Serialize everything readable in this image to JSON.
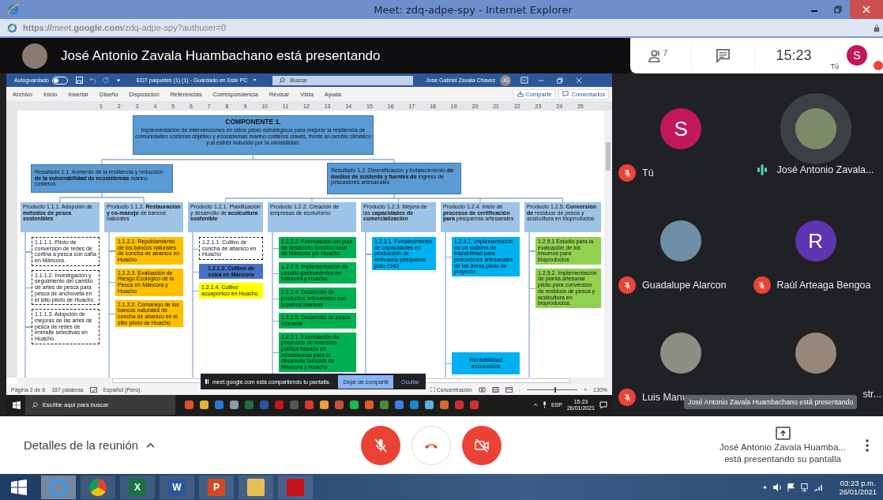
{
  "browser": {
    "title": "Meet: zdq-adpe-spy - Internet Explorer",
    "url": "**https://**meet.**google.com**/zdq-adpe-spy?authuser=0"
  },
  "presenting_banner": {
    "text": "José Antonio Zavala Huambachano está presentando"
  },
  "top_card": {
    "people_count": "7",
    "clock": "15:23",
    "self_label": "Tú",
    "self_initial": "S",
    "self_muted": true
  },
  "word": {
    "autosave_label": "Autoguardado",
    "autosave_on": false,
    "doc_title": "EDT paquetes (1) (1)  -  Guardado en Este PC",
    "search_placeholder": "Buscar",
    "user": "Jose Gabriel Zavala Chavez",
    "user_initials": "JG",
    "menu": [
      "Archivo",
      "Inicio",
      "Insertar",
      "Diseño",
      "Disposición",
      "Referencias",
      "Correspondencia",
      "Revisar",
      "Vista",
      "Ayuda"
    ],
    "share_button": "Compartir",
    "comments_button": "Comentarios",
    "ruler": [
      "1",
      "2",
      "3",
      "4",
      "5",
      "6",
      "7",
      "8",
      "9",
      "10",
      "11",
      "12",
      "13",
      "14",
      "15",
      "16",
      "17",
      "18",
      "19",
      "20",
      "21",
      "22",
      "23",
      "24",
      "25"
    ],
    "diagram": {
      "kind": "component",
      "title": "COMPONENTE 1.",
      "text": "Implementación de intervenciones en sitios piloto estratégicos para mejorar la resiliencia de comunidades costeras objetivo y ecosistemas marino costeros claves, frente al cambio climático y al estrés inducido por la variabilidad.",
      "children": [
        {
          "kind": "result",
          "text": "Resultado 1.1. Aumento de la resiliencia y reducción **de la vulnerabilidad de ecosistemas** marino costeros",
          "children": [
            {
              "kind": "product",
              "text": "Producto 1.1.1. Adopción de **métodos de pesca sostenibles**",
              "children": [
                {
                  "kind": "dashed",
                  "text": "1.1.1.1. Piloto de conversión de redes de cortina a pesca con caña en Máncora."
                },
                {
                  "kind": "dashed",
                  "text": "1.1.1.2. Investigación y seguimiento del cambio de artes de pesca para pesca de anchoveta en el sitio piloto de Huacho."
                },
                {
                  "kind": "dashed",
                  "text": "1.1.1.3. Adopción de mejoras de las artes de pesca de redes de enmalle selectivas en Huacho."
                }
              ]
            },
            {
              "kind": "product",
              "text": "Producto 1.1.2. **Restauración y co-manejo** de bancos naturales",
              "children": [
                {
                  "kind": "orange",
                  "text": "1.1.2.1. Repoblamiento de los bancos naturales de concha de abanico en Huacho"
                },
                {
                  "kind": "orange",
                  "text": "1.1.2.3. Evaluación de Riesgo Ecológico de la Pesca en Máncora y Huacho"
                },
                {
                  "kind": "orange",
                  "text": "1.1.2.2. Comanejo de los bancos naturales de concha de abanico en el sitio piloto de Huacho"
                }
              ]
            }
          ]
        },
        {
          "kind": "result",
          "text": "Resultado 1.2. Diversificación y fortalecimiento **de medios de sustento y fuentes de** ingreso de pescadores artesanales",
          "children": [
            {
              "kind": "product",
              "text": "Producto 1.2.1. Planificación y desarrollo de **acuicultura sostenible**",
              "children": [
                {
                  "kind": "dashed",
                  "text": "1.2.1.1. Cultivo de concha de abanico en Huacho"
                },
                {
                  "kind": "navy",
                  "text": "1.2.1.2. Cultivo de ostra en Máncora"
                },
                {
                  "kind": "yellow",
                  "text": "1.2.1.4. Cultivo acuapónico en Huacho"
                }
              ]
            },
            {
              "kind": "product",
              "text": "Producto 1.2.2. Creación de empresas de ecoturismo",
              "children": [
                {
                  "kind": "green",
                  "text": "1.2.2.2. Formulación del plan de desarrollo turístico local de Máncora y/o Huacho"
                },
                {
                  "kind": "green",
                  "text": "1.2.2.3. Implementación de circuito gastronómico en Máncora y Huacho"
                },
                {
                  "kind": "green",
                  "text": "1.2.2.4. Desarrollo de productos artesanales con insumos marinos"
                },
                {
                  "kind": "green",
                  "text": "1.2.2.5. Desarrollo de pesca vivencial"
                },
                {
                  "kind": "green",
                  "text": "1.2.2.1. Formulación de proyectos de inversión pública basada en ecosistemas para el desarrollo turístico de Máncora y Huacho"
                }
              ]
            },
            {
              "kind": "product",
              "text": "Producto 1.2.3. Mejora de las **capacidades de comercialización**",
              "children": [
                {
                  "kind": "cyan",
                  "text": "1.2.3.1. Fortalecimiento de capacidades en producción de derivados pesqueros  para CHD"
                }
              ]
            },
            {
              "kind": "product",
              "text": "Producto 1.2.4. Inicio de **procesos de certificación para** pesquerías artesanales",
              "children": [
                {
                  "kind": "cyan",
                  "text": "1.2.4.1. Implementación de un sistema de trazabilidad para pescadores artesanales de las áreas piloto de proyecto"
                },
                {
                  "kind": "cyan-center",
                  "text": "Rentabilidad economica"
                }
              ]
            },
            {
              "kind": "product",
              "text": "Producto 1.2.5. **Conversión de** residuos de pesca y acuicultura en bioproductos",
              "children": [
                {
                  "kind": "lime",
                  "text": "1.2.5.1 Estudio para la evaluación de los insumos para bioproductos"
                },
                {
                  "kind": "lime",
                  "text": "1.2.5.2. Implementación de planta artesanal piloto para conversión de residuos de pesca y acuicultura en bioproductos."
                }
              ]
            }
          ]
        }
      ]
    },
    "status": {
      "page": "Página 2 de 6",
      "words": "187 palabras",
      "language": "Español (Perú)",
      "focus": "Concentración",
      "zoom_out": "-",
      "zoom_in": "+",
      "zoom": "130%",
      "level": 0.55
    }
  },
  "share_notice": {
    "text": "meet.google.com está compartiendo tu pantalla.",
    "stop": "Dejar de compartir",
    "hide": "Ocultar"
  },
  "shared_taskbar": {
    "search_placeholder": "Escribe aquí para buscar",
    "lang": "ESP",
    "time": "15:23",
    "date": "26/01/2021"
  },
  "participants": [
    {
      "name": "Tú",
      "kind": "initial",
      "initial": "S",
      "color": "#c2185b",
      "muted": true,
      "speaking": false
    },
    {
      "name": "José Antonio Zavala...",
      "kind": "photo",
      "muted": false,
      "speaking": true
    },
    {
      "name": "Guadalupe Alarcon",
      "kind": "photo",
      "muted": true,
      "speaking": false
    },
    {
      "name": "Raúl Arteaga Bengoa",
      "kind": "initial",
      "initial": "R",
      "color": "#5e35b1",
      "muted": true,
      "speaking": false
    },
    {
      "name": "Luis Manu",
      "kind": "photo",
      "muted": true,
      "speaking": false
    },
    {
      "name": "str...",
      "kind": "photo",
      "muted": false,
      "speaking": false
    }
  ],
  "tooltip": "José Antonio Zavala Huambachano está presentando",
  "controls": {
    "details": "Detalles de la reunión",
    "mic_on": false,
    "camera_on": false,
    "presenter": "José Antonio Zavala Huamba...",
    "presenter_status": "está presentando su pantalla"
  },
  "taskbar": {
    "apps": [
      {
        "kind": "ie",
        "selected": true
      },
      {
        "kind": "chrome",
        "selected": false
      },
      {
        "kind": "excel",
        "letter": "X",
        "selected": false
      },
      {
        "kind": "word",
        "letter": "W",
        "selected": false
      },
      {
        "kind": "powerpoint",
        "letter": "P",
        "selected": false
      },
      {
        "kind": "files",
        "selected": false
      },
      {
        "kind": "acrobat",
        "selected": false
      }
    ],
    "time": "03:23 p.m.",
    "date": "26/01/2021"
  }
}
